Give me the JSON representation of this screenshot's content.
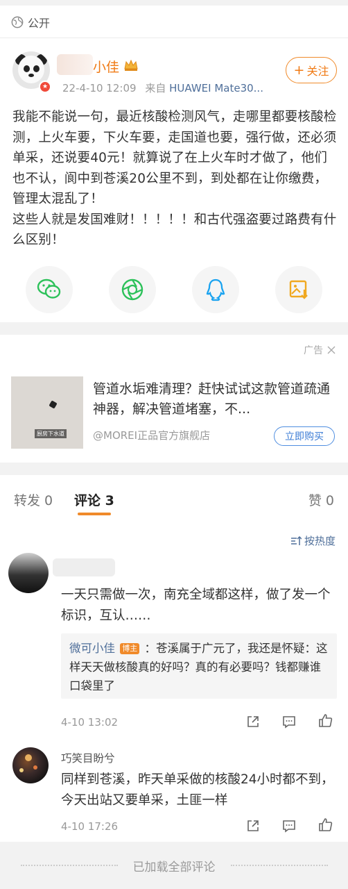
{
  "post": {
    "visibility": "公开",
    "username": "小佳",
    "time": "22-4-10 12:09",
    "source_prefix": "来自",
    "device": "HUAWEI Mate30...",
    "follow_label": "关注",
    "text": "我能不能说一句，最近核酸检测风气，走哪里都要核酸检测，上火车要，下火车要，走国道也要，强行做，还必须单采，还说要40元！就算说了在上火车时才做了，他们也不认，阆中到苍溪20公里不到，到处都在让你缴费，管理太混乱了！\n这些人就是发国难财！！！！！和古代强盗要过路费有什么区别！",
    "share_icons": [
      "wechat-icon",
      "moments-icon",
      "qq-icon",
      "save-image-icon"
    ]
  },
  "ad": {
    "label": "广告",
    "title": "管道水垢难清理？赶快试试这款管道疏通神器，解决管道堵塞，不...",
    "source": "@MOREI正品官方旗舰店",
    "button": "立即购买",
    "thumb_caption": "厨房下水道"
  },
  "tabs": {
    "repost": "转发 0",
    "comment": "评论 3",
    "like": "赞 0"
  },
  "sort_label": "按热度",
  "comments": [
    {
      "text": "一天只需做一次，南充全域都这样，做了发一个标识，互认……",
      "reply": {
        "name": "微可小佳",
        "badge": "博主",
        "text": "：苍溪属于广元了，我还是怀疑：这样天天做核酸真的好吗？真的有必要吗？钱都赚谁口袋里了"
      },
      "time": "4-10 13:02"
    },
    {
      "name": "巧笑目盼兮",
      "text": "同样到苍溪，昨天单采做的核酸24小时都不到，今天出站又要单采，土匪一样",
      "time": "4-10 17:26"
    }
  ],
  "footer": "已加载全部评论",
  "colors": {
    "accent": "#f08a2a",
    "link": "#4f6f9a",
    "wechat": "#2dc15a",
    "qq": "#1aa3f0",
    "save": "#f0a820"
  }
}
